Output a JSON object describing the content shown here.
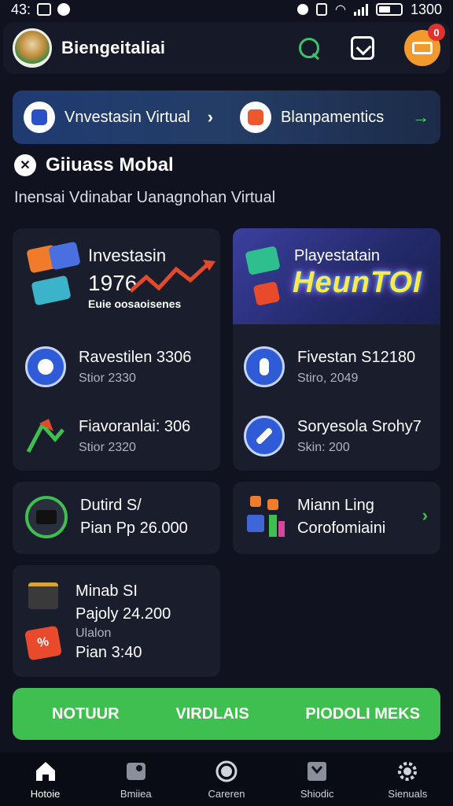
{
  "status_bar": {
    "time": "43:",
    "clock": "1300"
  },
  "header": {
    "title": "Biengeitaliai",
    "notification_count": "0"
  },
  "banner": {
    "item_1": "Vnvestasin Virtual",
    "item_2": "Blanpamentics"
  },
  "section": {
    "title": "Giiuass Mobal",
    "subtitle": "Inensai Vdinabar Uanagnohan Virtual"
  },
  "cards": {
    "promo_left": {
      "title": "Investasin",
      "amount": "1976",
      "tag": "Euie oosaoisenes"
    },
    "promo_right": {
      "title": "Playestatain",
      "neon": "HeunTOI"
    },
    "left_rows": [
      {
        "title": "Ravestilen 3306",
        "sub": "Stior 2330"
      },
      {
        "title": "Fiavoranlai: 306",
        "sub": "Stior 2320"
      }
    ],
    "right_rows": [
      {
        "title": "Fivestan S12180",
        "sub": "Stiro, 2049"
      },
      {
        "title": "Soryesola Srohy7",
        "sub": "Skin: 200"
      }
    ],
    "card_3": {
      "title": "Dutird S/",
      "sub": "Pian Pp 26.000"
    },
    "card_4": {
      "title": "Miann Ling",
      "sub": "Corofomiaini"
    },
    "card_5": {
      "title": "Minab SI",
      "line_2": "Pajoly 24.200",
      "line_3": "Ulalon",
      "line_4": "Pian 3:40"
    }
  },
  "cta": {
    "items": [
      "NOTUUR",
      "VIRDLAIS",
      "PIODOLI MEKS"
    ]
  },
  "nav": {
    "items": [
      "Hotoie",
      "Bmiiea",
      "Careren",
      "Shiodic",
      "Sienuals"
    ]
  },
  "colors": {
    "accent_green": "#3fbf4f",
    "bg": "#10131f",
    "card": "#1a1e2c",
    "banner": "#1f3b72"
  }
}
